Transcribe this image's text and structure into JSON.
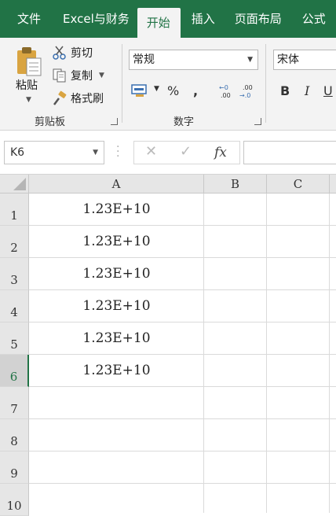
{
  "ribbon_tabs": [
    "文件",
    "Excel与财务",
    "开始",
    "插入",
    "页面布局",
    "公式"
  ],
  "active_tab": "开始",
  "clipboard": {
    "paste_label": "粘贴",
    "cut_label": "剪切",
    "copy_label": "复制",
    "format_painter_label": "格式刷",
    "group_label": "剪贴板"
  },
  "number": {
    "format_value": "常规",
    "percent": "%",
    "comma": ",",
    "increase_decimal": "←0\n.00",
    "decrease_decimal": ".00\n→.0",
    "group_label": "数字"
  },
  "font": {
    "font_value": "宋体",
    "bold": "B",
    "italic": "I",
    "underline": "U"
  },
  "formula_bar": {
    "name_box": "K6",
    "fx": "fx",
    "formula": ""
  },
  "columns": [
    "A",
    "B",
    "C"
  ],
  "rows": [
    "1",
    "2",
    "3",
    "4",
    "5",
    "6",
    "7",
    "8",
    "9",
    "10"
  ],
  "selected_row": "6",
  "cells": {
    "A1": "1.23E+10",
    "A2": "1.23E+10",
    "A3": "1.23E+10",
    "A4": "1.23E+10",
    "A5": "1.23E+10",
    "A6": "1.23E+10"
  },
  "colors": {
    "brand": "#217346",
    "ribbon_bg": "#f3f3f3",
    "header_bg": "#e6e6e6"
  }
}
